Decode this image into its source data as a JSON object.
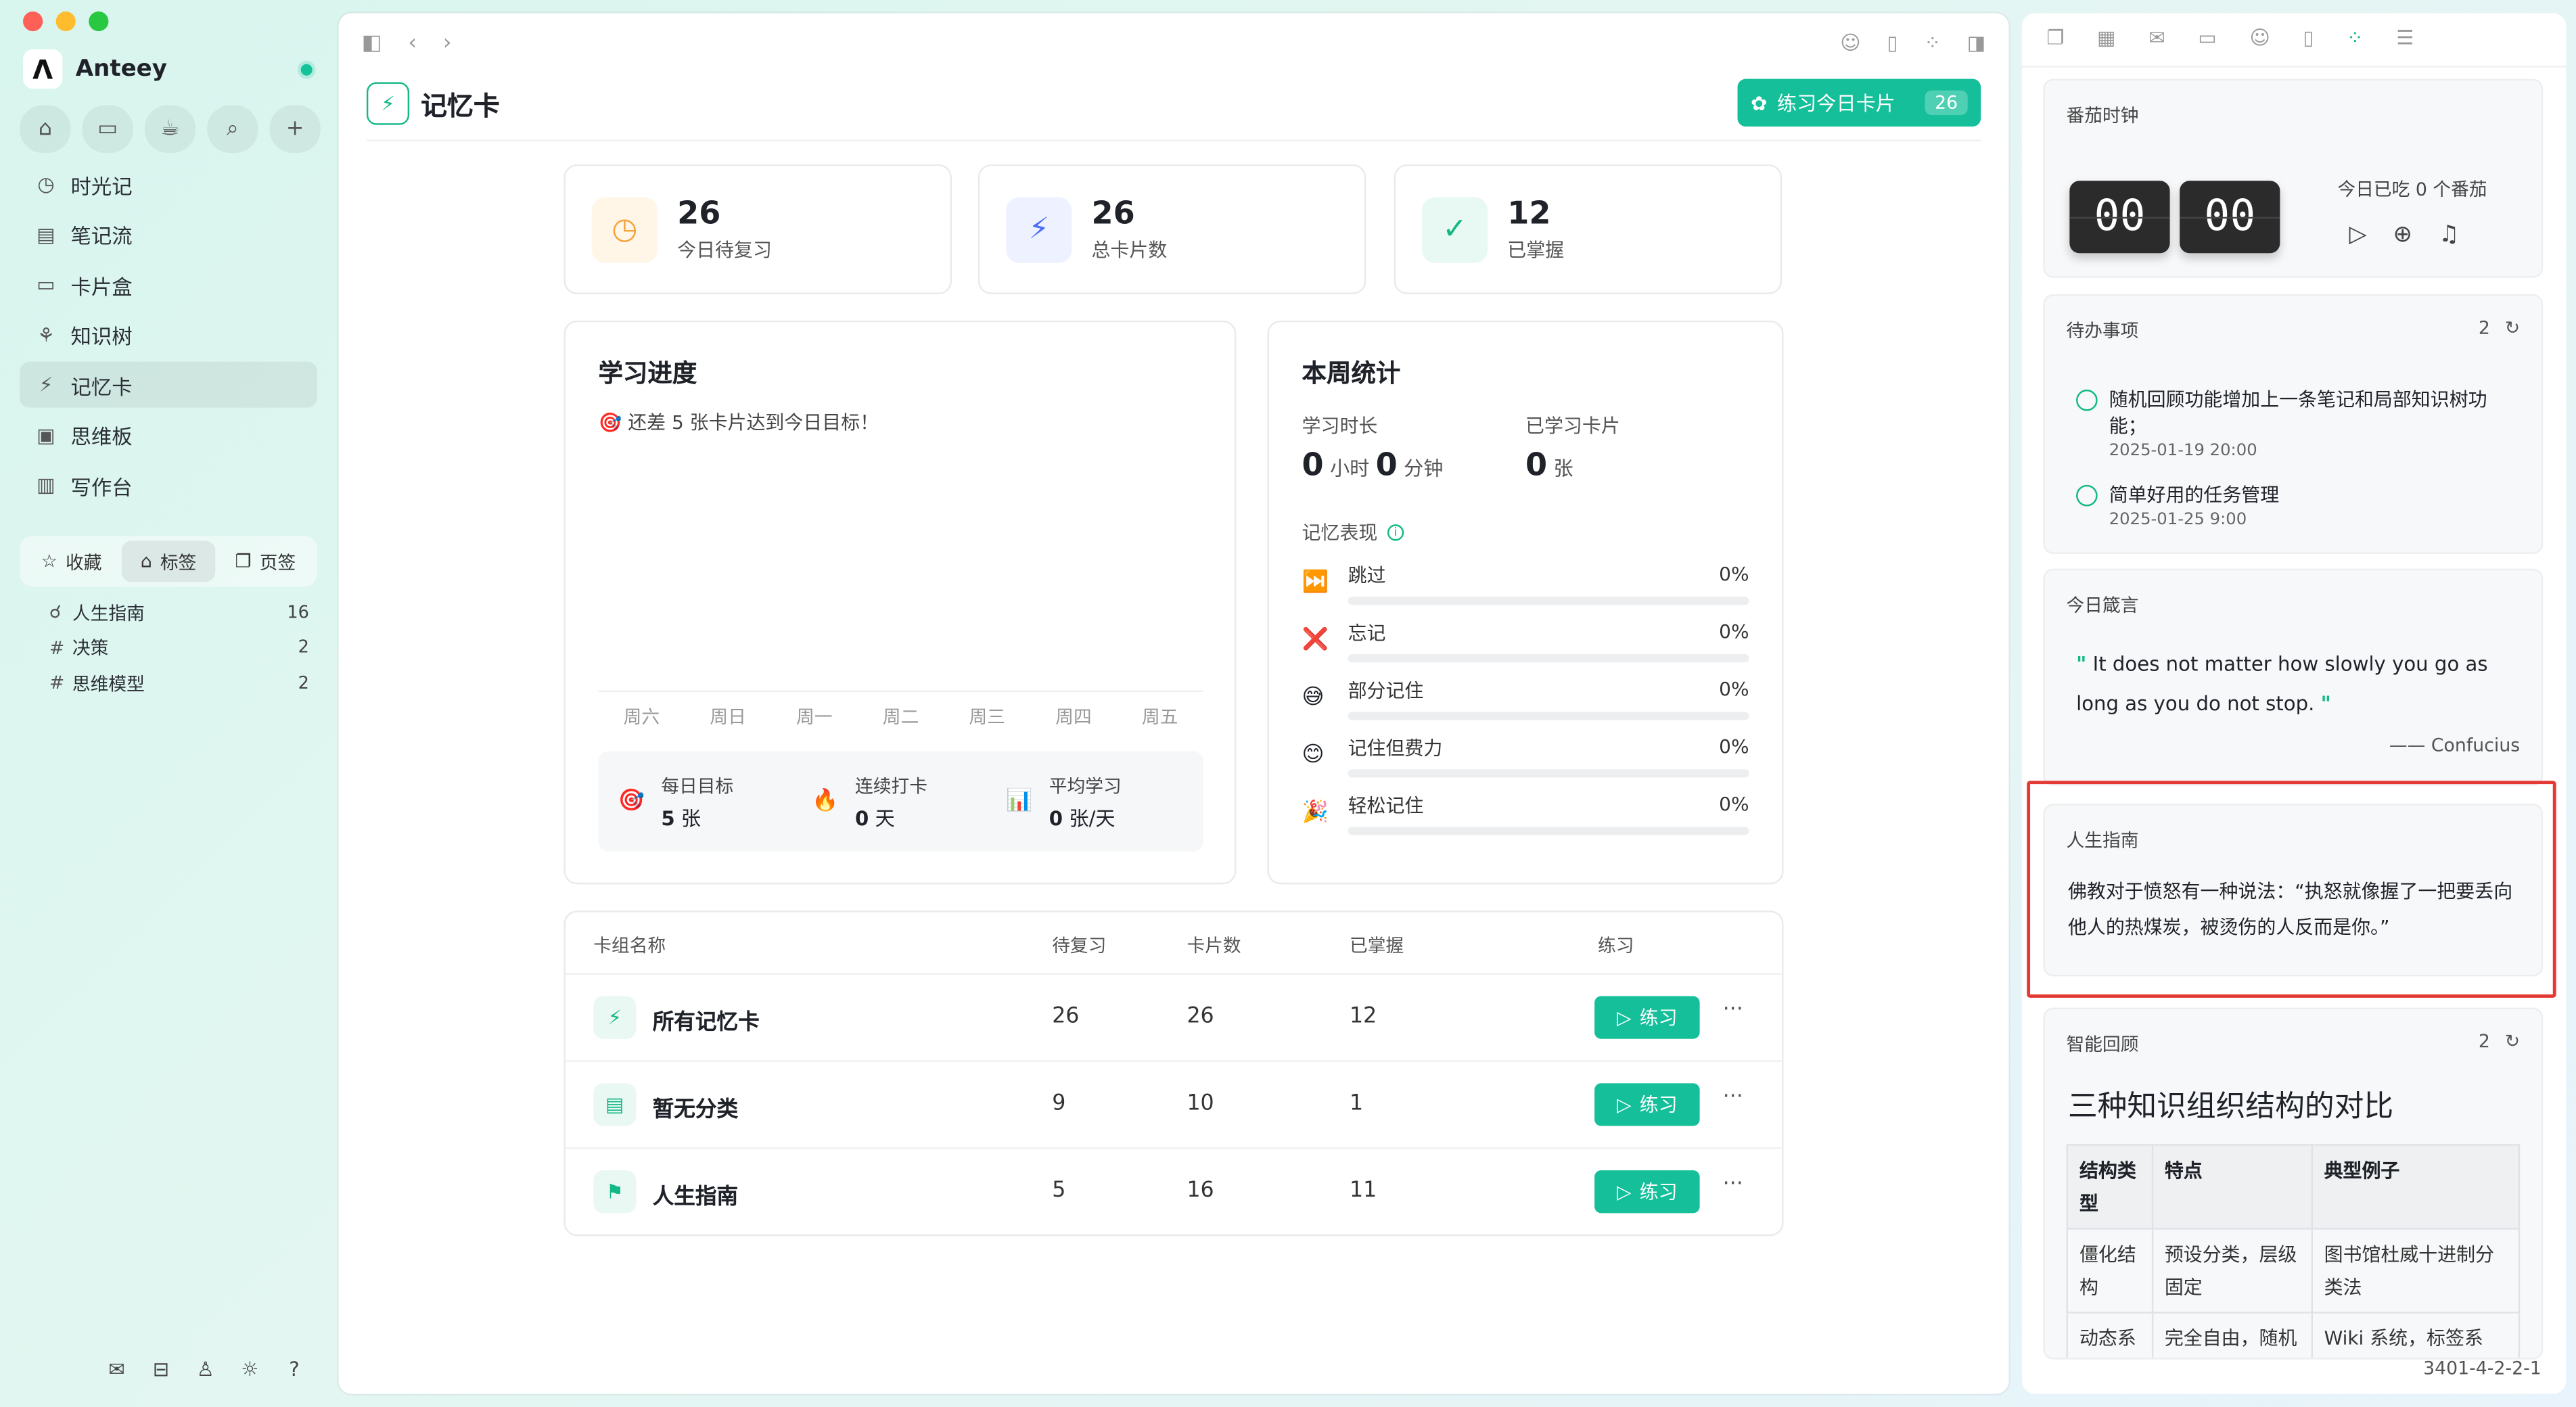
{
  "app": {
    "name": "Anteey"
  },
  "sidebar": {
    "nav": [
      {
        "label": "时光记",
        "icon": "clock-icon",
        "glyph": "◷"
      },
      {
        "label": "笔记流",
        "icon": "notebook-icon",
        "glyph": "▤"
      },
      {
        "label": "卡片盒",
        "icon": "box-icon",
        "glyph": "▭"
      },
      {
        "label": "知识树",
        "icon": "sprout-icon",
        "glyph": "⚘"
      },
      {
        "label": "记忆卡",
        "icon": "flashcard-icon",
        "glyph": "⚡"
      },
      {
        "label": "思维板",
        "icon": "whiteboard-icon",
        "glyph": "▣"
      },
      {
        "label": "写作台",
        "icon": "writing-desk-icon",
        "glyph": "▥"
      }
    ],
    "tabs": [
      {
        "label": "收藏",
        "glyph": "☆"
      },
      {
        "label": "标签",
        "glyph": "⌂"
      },
      {
        "label": "页签",
        "glyph": "❐"
      }
    ],
    "tags": [
      {
        "label": "人生指南",
        "count": "16",
        "glyph": "☌"
      },
      {
        "label": "决策",
        "count": "2",
        "glyph": "#"
      },
      {
        "label": "思维模型",
        "count": "2",
        "glyph": "#"
      }
    ]
  },
  "main": {
    "title": "记忆卡",
    "practice_today_label": "练习今日卡片",
    "practice_today_count": "26",
    "stats": [
      {
        "value": "26",
        "label": "今日待复习",
        "color": "#f6a23c",
        "bg": "#fff6e8",
        "glyph": "◷"
      },
      {
        "value": "26",
        "label": "总卡片数",
        "color": "#4c6ef5",
        "bg": "#eef1ff",
        "glyph": "⚡"
      },
      {
        "value": "12",
        "label": "已掌握",
        "color": "#12b886",
        "bg": "#e8f8f2",
        "glyph": "✓"
      }
    ],
    "progress": {
      "title": "学习进度",
      "subtitle": "🎯 还差 5 张卡片达到今日目标！",
      "weekdays": [
        "周六",
        "周日",
        "周一",
        "周二",
        "周三",
        "周四",
        "周五"
      ],
      "goals": [
        {
          "emoji": "🎯",
          "label": "每日目标",
          "value": "5",
          "unit": "张"
        },
        {
          "emoji": "🔥",
          "label": "连续打卡",
          "value": "0",
          "unit": "天"
        },
        {
          "emoji": "📊",
          "label": "平均学习",
          "value": "0",
          "unit": "张/天"
        }
      ]
    },
    "weekly": {
      "title": "本周统计",
      "study_time_label": "学习时长",
      "hours": "0",
      "hours_unit": "小时",
      "minutes": "0",
      "minutes_unit": "分钟",
      "cards_label": "已学习卡片",
      "cards": "0",
      "cards_unit": "张",
      "memory_title": "记忆表现",
      "memory": [
        {
          "emoji": "⏭️",
          "label": "跳过",
          "pct": "0%"
        },
        {
          "emoji": "❌",
          "label": "忘记",
          "pct": "0%"
        },
        {
          "emoji": "😅",
          "label": "部分记住",
          "pct": "0%"
        },
        {
          "emoji": "😊",
          "label": "记住但费力",
          "pct": "0%"
        },
        {
          "emoji": "🎉",
          "label": "轻松记住",
          "pct": "0%"
        }
      ]
    },
    "table": {
      "headers": {
        "name": "卡组名称",
        "due": "待复习",
        "cards": "卡片数",
        "mastered": "已掌握",
        "practice": "练习"
      },
      "practice_label": "练习",
      "more": "···",
      "rows": [
        {
          "name": "所有记忆卡",
          "due": "26",
          "cards": "26",
          "mastered": "12",
          "glyph": "⚡"
        },
        {
          "name": "暂无分类",
          "due": "9",
          "cards": "10",
          "mastered": "1",
          "glyph": "▤"
        },
        {
          "name": "人生指南",
          "due": "5",
          "cards": "16",
          "mastered": "11",
          "glyph": "⚑"
        }
      ]
    }
  },
  "right": {
    "pomodoro": {
      "title": "番茄时钟",
      "minutes": "00",
      "seconds": "00",
      "status": "今日已吃 0 个番茄"
    },
    "todo": {
      "title": "待办事项",
      "count": "2",
      "items": [
        {
          "text": "随机回顾功能增加上一条笔记和局部知识树功能；",
          "date": "2025-01-19 20:00"
        },
        {
          "text": "简单好用的任务管理",
          "date": "2025-01-25 9:00"
        }
      ]
    },
    "quote": {
      "title": "今日箴言",
      "open_mark": "\"",
      "text": "It does not matter how slowly you go as long as you do not stop.",
      "close_mark": "\"",
      "author": "—— Confucius"
    },
    "guide": {
      "title": "人生指南",
      "text": "佛教对于愤怒有一种说法：“执怒就像握了一把要丢向他人的热煤炭，被烫伤的人反而是你。”"
    },
    "review": {
      "title": "智能回顾",
      "count": "2",
      "heading": "三种知识组织结构的对比",
      "columns": [
        "结构类型",
        "特点",
        "典型例子"
      ],
      "rows": [
        [
          "僵化结构",
          "预设分类，层级固定",
          "图书馆杜威十进制分类法"
        ],
        [
          "动态系统",
          "完全自由，随机连接",
          "Wiki 系统，标签系统，双链"
        ]
      ]
    },
    "footer_id": "3401-4-2-2-1"
  },
  "colors": {
    "accent": "#14bf9a",
    "highlight": "#e53935"
  }
}
